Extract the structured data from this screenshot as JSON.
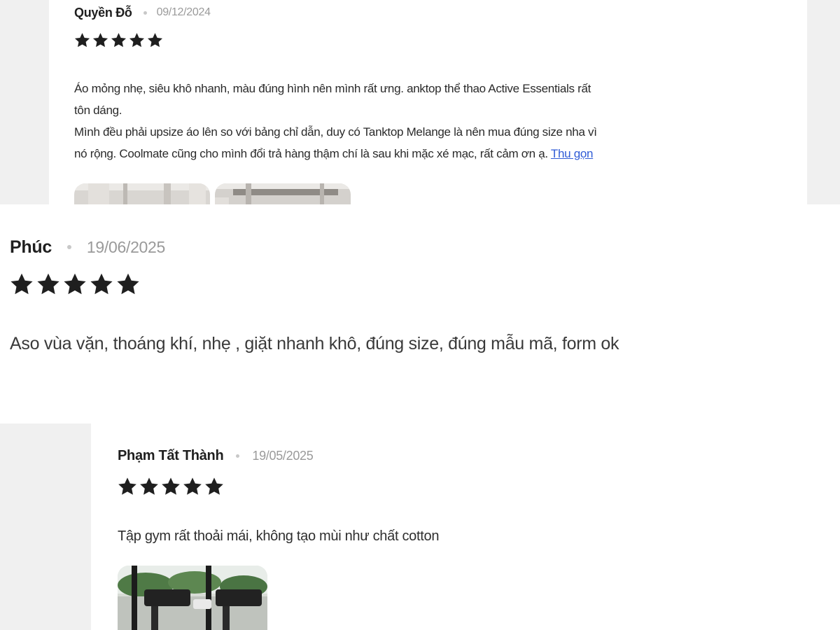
{
  "reviews": [
    {
      "author": "Quyền Đỗ",
      "date": "09/12/2024",
      "rating": 5,
      "text_line1": "Áo mỏng nhẹ, siêu khô nhanh, màu đúng hình nên mình rất ưng. anktop thể thao Active Essentials rất",
      "text_line2": "tôn dáng.",
      "text_line3": "Mình đều phải upsize áo lên so với bảng chỉ dẫn, duy có Tanktop Melange là nên mua đúng size nha vì",
      "text_line4": "nó rộng. Coolmate cũng cho mình đổi trả hàng thậm chí là sau khi mặc xé mạc, rất cảm ơn ạ.",
      "collapse_label": "Thu gọn"
    },
    {
      "author": "Phúc",
      "date": "19/06/2025",
      "rating": 5,
      "text": "Aso vùa vặn, thoáng khí, nhẹ , giặt nhanh khô, đúng size, đúng mẫu mã, form ok"
    },
    {
      "author": "Phạm Tất Thành",
      "date": "19/05/2025",
      "rating": 5,
      "text": "Tập gym rất thoải mái, không tạo mùi như chất cotton"
    }
  ],
  "colors": {
    "star": "#1f1f1f",
    "link": "#2f5bd6",
    "page_gray": "#f0f0f0",
    "date_gray": "#9a9a9a"
  }
}
